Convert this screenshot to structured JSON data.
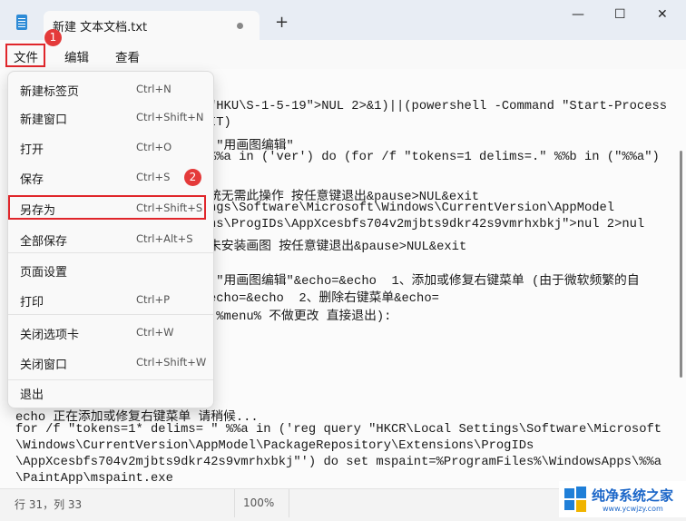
{
  "window": {
    "tab_title": "新建 文本文档.txt",
    "new_tab": "+",
    "minimize": "—",
    "maximize": "☐",
    "close": "✕"
  },
  "menubar": {
    "items": [
      "文件",
      "编辑",
      "查看"
    ],
    "settings_icon": "gear-icon"
  },
  "annotations": {
    "badge1": "1",
    "badge2": "2",
    "accent": "#e0262b"
  },
  "file_menu": [
    {
      "label": "新建标签页",
      "shortcut": "Ctrl+N"
    },
    {
      "label": "新建窗口",
      "shortcut": "Ctrl+Shift+N"
    },
    {
      "label": "打开",
      "shortcut": "Ctrl+O"
    },
    {
      "label": "保存",
      "shortcut": "Ctrl+S"
    },
    {
      "label": "另存为",
      "shortcut": "Ctrl+Shift+S"
    },
    {
      "label": "全部保存",
      "shortcut": "Ctrl+Alt+S"
    },
    {
      "label": "页面设置",
      "shortcut": ""
    },
    {
      "label": "打印",
      "shortcut": "Ctrl+P"
    },
    {
      "label": "关闭选项卡",
      "shortcut": "Ctrl+W"
    },
    {
      "label": "关闭窗口",
      "shortcut": "Ctrl+Shift+W"
    },
    {
      "label": "退出",
      "shortcut": ""
    }
  ],
  "editor": {
    "partial_lines": [
      "\"HKU\\S-1-5-19\">NUL 2>&1)||(powershell -Command \"Start-Process",
      "IT)",
      "]\"用画图编辑\"",
      "%%a in ('ver') do (for /f \"tokens=1 delims=.\" %%b in (\"%%a\")",
      "",
      "统无需此操作 按任意键退出&pause>NUL&exit",
      "ngs\\Software\\Microsoft\\Windows\\CurrentVersion\\AppModel",
      "ns\\ProgIDs\\AppXcesbfs704v2mjbts9dkr42s9vmrhxbkj\">nul 2>nul",
      "未安装画图 按任意键退出&pause>NUL&exit",
      "",
      "]\"用画图编辑\"&echo=&echo  1、添加或修复右键菜单 (由于微软频繁的自",
      "echo=&echo  2、删除右键菜单&echo=",
      " %menu% 不做更改 直接退出):"
    ],
    "full_lines": [
      "echo 正在添加或修复右键菜单 请稍候...",
      "for /f \"tokens=1* delims= \" %%a in ('reg query \"HKCR\\Local Settings\\Software\\Microsoft",
      "\\Windows\\CurrentVersion\\AppModel\\PackageRepository\\Extensions\\ProgIDs",
      "\\AppXcesbfs704v2mjbts9dkr42s9vmrhxbkj\"') do set mspaint=%ProgramFiles%\\WindowsApps\\%%a",
      "\\PaintApp\\mspaint.exe"
    ]
  },
  "status": {
    "position": "行 31，列 33",
    "zoom": "100%"
  },
  "watermark": {
    "name": "纯净系统之家",
    "url": "www.ycwjzy.com"
  }
}
